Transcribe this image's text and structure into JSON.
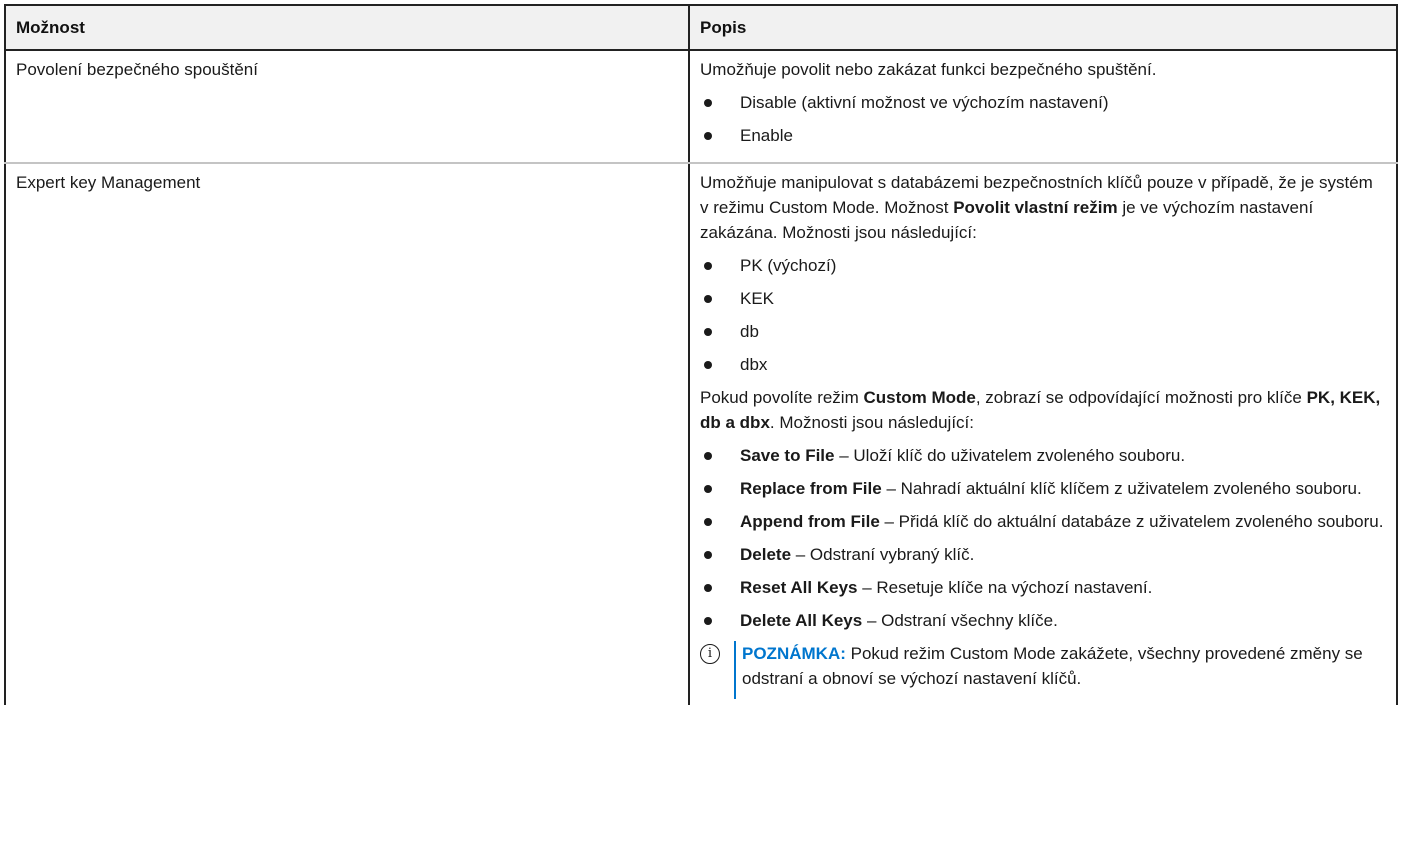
{
  "header": {
    "option": "Možnost",
    "description": "Popis"
  },
  "rows": [
    {
      "option": "Povolení bezpečného spouštění",
      "intro": "Umožňuje povolit nebo zakázat funkci bezpečného spuštění.",
      "items": [
        "Disable (aktivní možnost ve výchozím nastavení)",
        "Enable"
      ]
    },
    {
      "option": "Expert key Management",
      "intro": {
        "before": "Umožňuje manipulovat s databázemi bezpečnostních klíčů pouze v případě, že je systém v režimu Custom Mode. Možnost ",
        "bold": "Povolit vlastní režim",
        "after": " je ve výchozím nastavení zakázána. Možnosti jsou následující:"
      },
      "key_items": [
        "PK (výchozí)",
        "KEK",
        "db",
        "dbx"
      ],
      "custom": {
        "p1": "Pokud povolíte režim ",
        "b1": "Custom Mode",
        "p2": ", zobrazí se odpovídající možnosti pro klíče ",
        "b2": "PK, KEK, db a dbx",
        "p3": ". Možnosti jsou následující:"
      },
      "actions": [
        {
          "label": "Save to File",
          "text": " – Uloží klíč do uživatelem zvoleného souboru."
        },
        {
          "label": "Replace from File",
          "text": " – Nahradí aktuální klíč klíčem z uživatelem zvoleného souboru."
        },
        {
          "label": "Append from File",
          "text": " – Přidá klíč do aktuální databáze z uživatelem zvoleného souboru."
        },
        {
          "label": "Delete",
          "text": " – Odstraní vybraný klíč."
        },
        {
          "label": "Reset All Keys",
          "text": " – Resetuje klíče na výchozí nastavení."
        },
        {
          "label": "Delete All Keys",
          "text": " – Odstraní všechny klíče."
        }
      ],
      "note": {
        "icon": "i",
        "label": "POZNÁMKA:",
        "text": " Pokud režim Custom Mode zakážete, všechny provedené změny se odstraní a obnoví se výchozí nastavení klíčů."
      }
    }
  ]
}
